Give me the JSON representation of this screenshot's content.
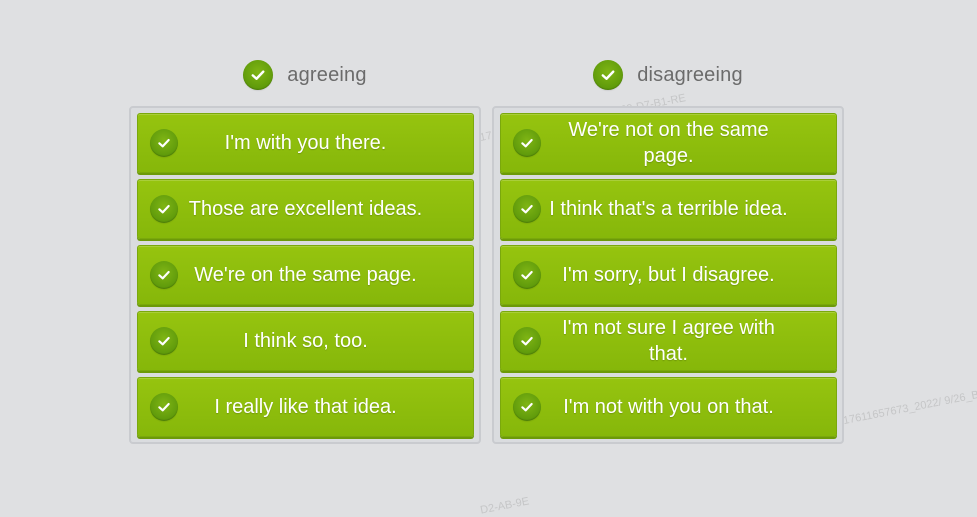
{
  "columns": [
    {
      "title": "agreeing",
      "items": [
        "I'm with you there.",
        "Those are excellent ideas.",
        "We're on the same page.",
        "I think so, too.",
        "I really like that idea."
      ]
    },
    {
      "title": "disagreeing",
      "items": [
        "We're not on the same page.",
        "I think that's a terrible idea.",
        "I'm sorry, but I disagree.",
        "I'm not sure I agree with that.",
        "I'm not with you on that."
      ]
    }
  ],
  "watermarks": [
    "1761165767_2022/ 9/26_EC-63-D7-B1-RE",
    "17611657673_2022/ 9/26_B",
    "D2-AB-9E"
  ],
  "colors": {
    "background": "#dfe0e2",
    "button_green": "#8fbf0e",
    "check_green": "#5f9a0b",
    "title_gray": "#6b6b6b"
  },
  "icons": {
    "header": "check-circle-icon",
    "item": "check-circle-icon"
  }
}
